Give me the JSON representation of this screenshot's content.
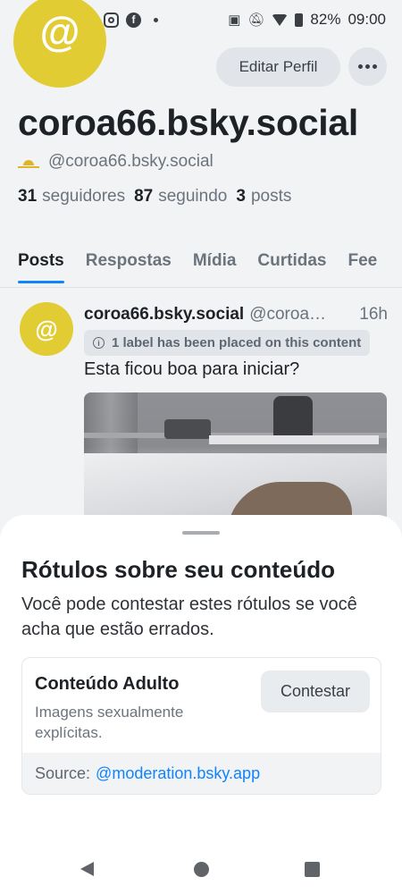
{
  "status_bar": {
    "battery": "82%",
    "time": "09:00"
  },
  "profile": {
    "display_name": "coroa66.bsky.social",
    "handle": "@coroa66.bsky.social",
    "avatar_glyph": "@",
    "edit_button": "Editar Perfil",
    "followers_count": "31",
    "followers_label": "seguidores",
    "following_count": "87",
    "following_label": "seguindo",
    "posts_count": "3",
    "posts_label": "posts"
  },
  "tabs": [
    {
      "label": "Posts",
      "active": true
    },
    {
      "label": "Respostas",
      "active": false
    },
    {
      "label": "Mídia",
      "active": false
    },
    {
      "label": "Curtidas",
      "active": false
    },
    {
      "label": "Fee",
      "active": false
    }
  ],
  "post": {
    "avatar_glyph": "@",
    "author": "coroa66.bsky.social",
    "handle": "@coroa66.bsky.social",
    "time": "16h",
    "label_notice": "1 label has been placed on this content",
    "text": "Esta ficou boa para iniciar?"
  },
  "sheet": {
    "title": "Rótulos sobre seu conteúdo",
    "description": "Você pode contestar estes rótulos se você acha que estão errados.",
    "label_card": {
      "name": "Conteúdo Adulto",
      "description": "Imagens sexualmente explícitas.",
      "contest_button": "Contestar",
      "source_prefix": "Source:",
      "source_link": "@moderation.bsky.app"
    }
  },
  "colors": {
    "accent": "#1083fe",
    "avatar": "#e2cc34",
    "background": "#f1f3f5"
  },
  "icons": [
    "instagram-icon",
    "facebook-icon",
    "nfc-icon",
    "mute-icon",
    "wifi-icon",
    "battery-icon",
    "more-icon",
    "sun-icon",
    "info-icon",
    "back-icon",
    "home-icon",
    "recents-icon"
  ]
}
